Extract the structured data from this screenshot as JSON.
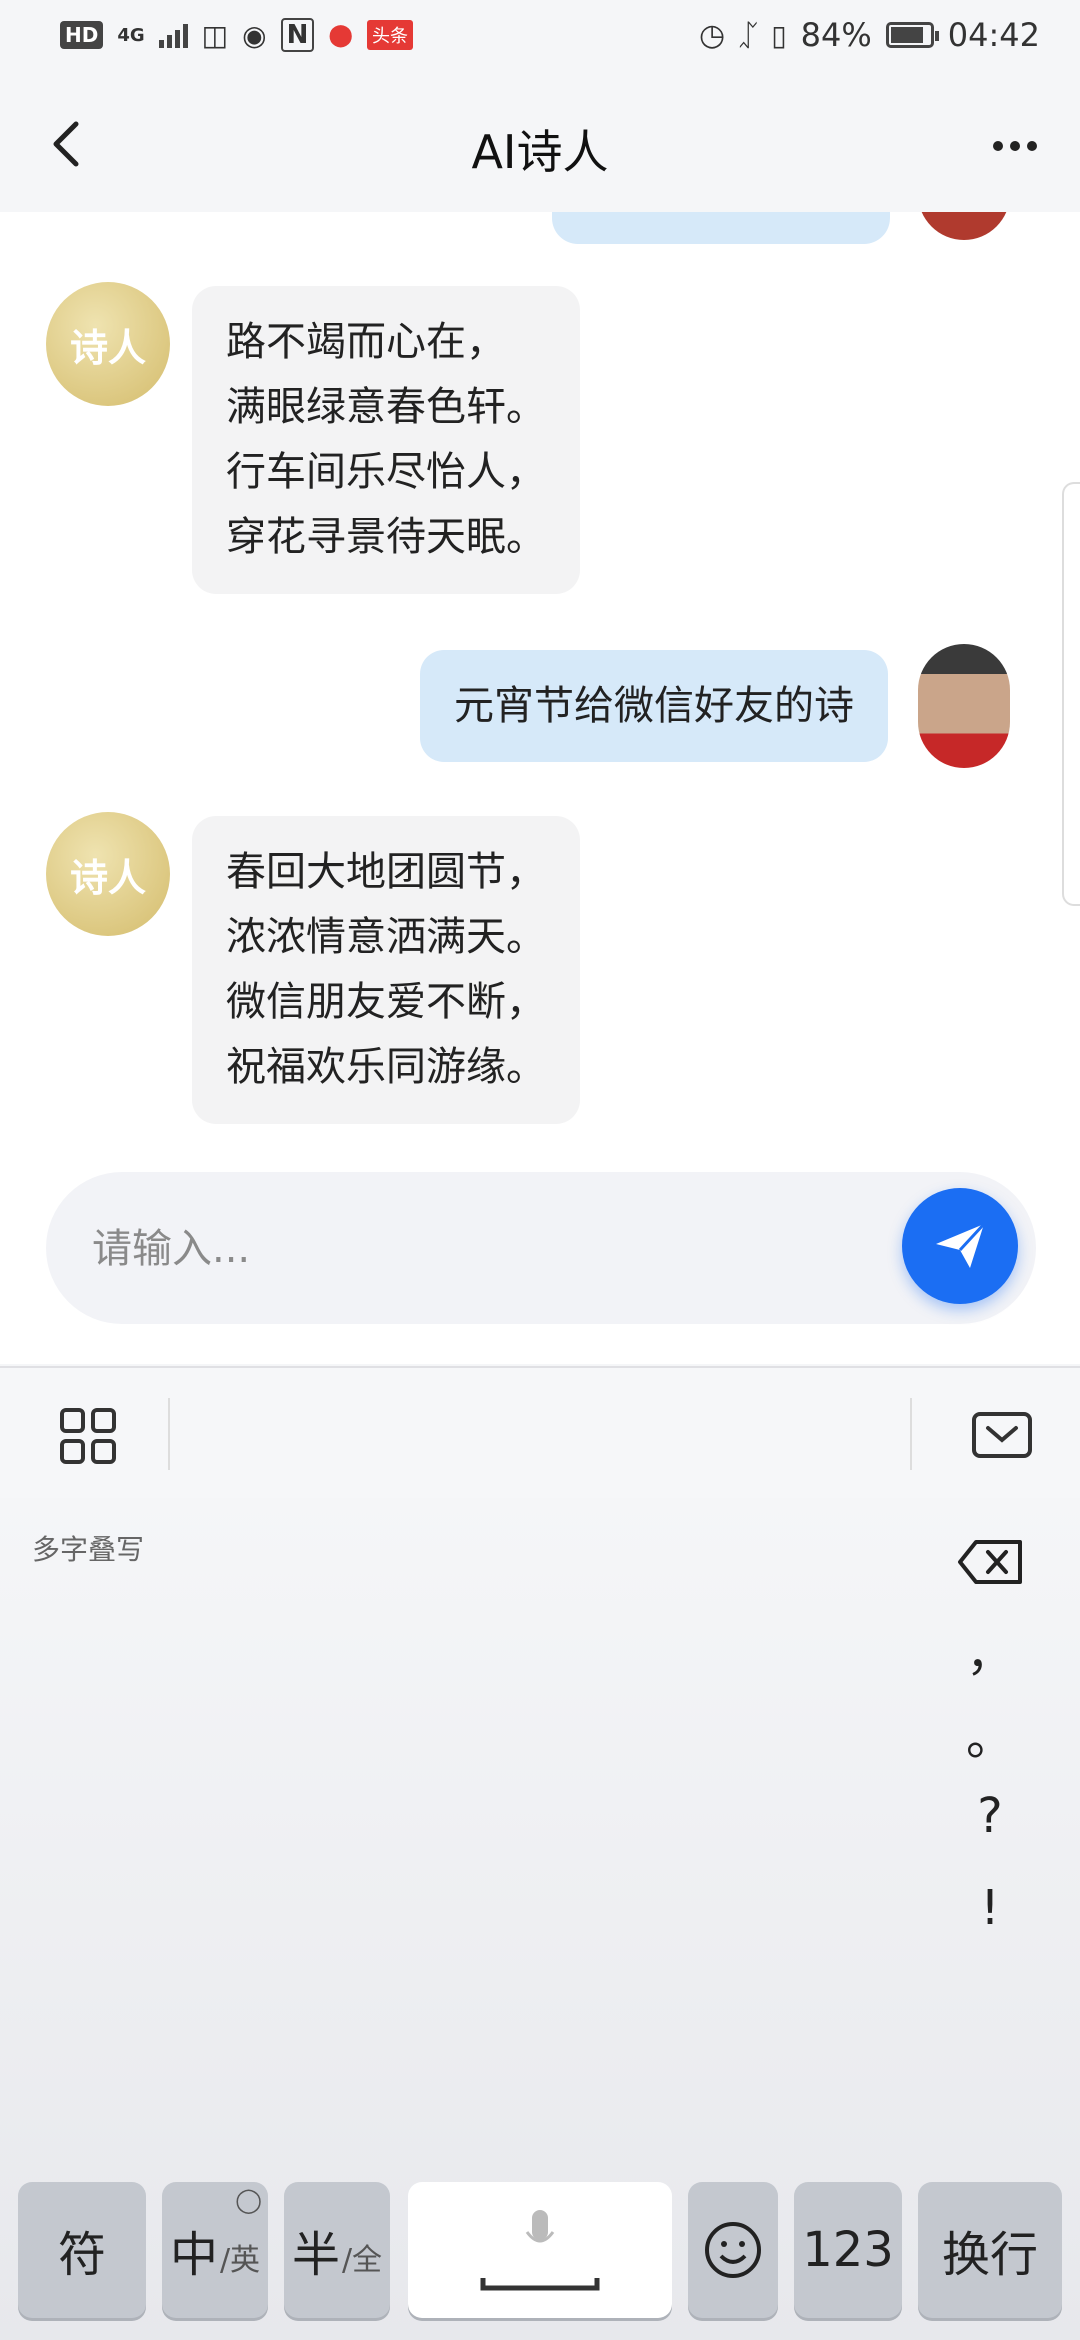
{
  "status_bar": {
    "left_badges": [
      "HD",
      "4G",
      "头条"
    ],
    "battery_percent": "84%",
    "battery_level": 0.84,
    "time": "04:42"
  },
  "header": {
    "title": "AI诗人",
    "back_icon": "chevron-left-icon",
    "more_icon": "more-dots-icon"
  },
  "chat": {
    "poet_avatar_text": "诗人",
    "messages": [
      {
        "side": "left",
        "text": "路不竭而心在，\n满眼绿意春色轩。\n行车间乐尽怡人，\n穿花寻景待天眠。"
      },
      {
        "side": "right",
        "text": "元宵节给微信好友的诗"
      },
      {
        "side": "left",
        "text": "春回大地团圆节，\n浓浓情意洒满天。\n微信朋友爱不断，\n祝福欢乐同游缘。"
      }
    ]
  },
  "input": {
    "placeholder": "请输入...",
    "value": "",
    "send_icon": "paper-plane-icon"
  },
  "keyboard": {
    "mode_label": "多字叠写",
    "side_keys": [
      "，",
      "。",
      "?",
      "!"
    ],
    "bottom_keys": {
      "symbols": "符",
      "lang_main": "中",
      "lang_sub": "/英",
      "width_main": "半",
      "width_sub": "/全",
      "numbers": "123",
      "enter": "换行"
    },
    "colors": {
      "accent": "#1b6ef3",
      "user_bubble": "#d6e9f9",
      "bot_bubble": "#f3f3f4"
    }
  }
}
